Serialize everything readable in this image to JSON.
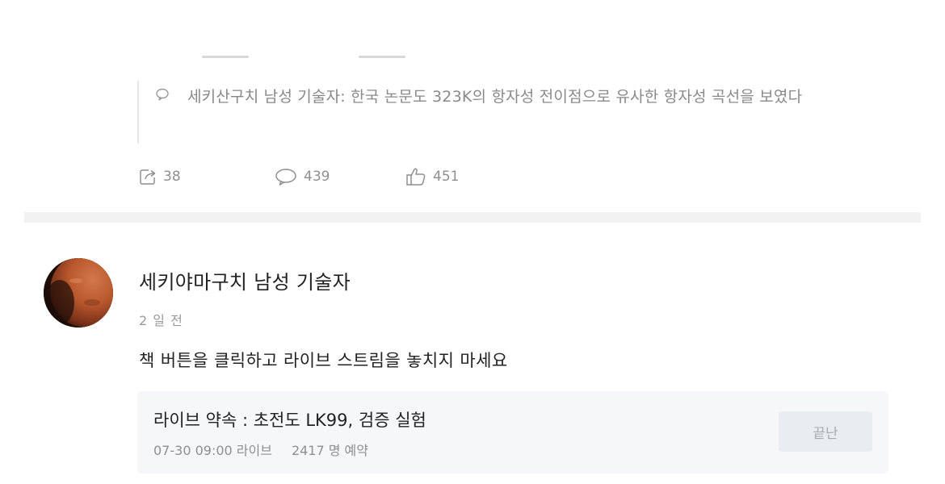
{
  "quoted_reply": {
    "author": "세키산구치 남성 기술자",
    "separator": ": ",
    "text": "한국 논문도 323K의 항자성 전이점으로 유사한 항자성 곡선을 보였다"
  },
  "actions": {
    "share_count": "38",
    "comment_count": "439",
    "like_count": "451"
  },
  "post": {
    "author_name": "세키야마구치 남성 기술자",
    "time": "2 일 전",
    "body": "책 버튼을 클릭하고 라이브 스트림을 놓치지 마세요"
  },
  "live_card": {
    "title": "라이브 약속 : 초전도 LK99, 검증 실험",
    "schedule": "07-30 09:00 라이브",
    "reservations": "2417 명 예약",
    "status_button": "끝난"
  },
  "colors": {
    "muted_text": "#8f8f8f",
    "divider": "#f2f2f2",
    "card_bg": "#f6f7f9",
    "button_bg": "#e9ecf1"
  }
}
